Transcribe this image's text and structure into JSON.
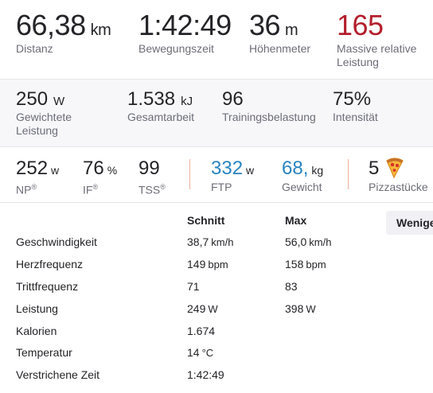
{
  "colors": {
    "accent_red": "#b41f2c",
    "accent_blue": "#2a84c2",
    "label_gray": "#6d6d78",
    "divider_orange": "#f0b29a"
  },
  "top_stats": [
    {
      "value": "66,38",
      "unit": "km",
      "label": "Distanz"
    },
    {
      "value": "1:42:49",
      "unit": "",
      "label": "Bewegungszeit"
    },
    {
      "value": "36",
      "unit": "m",
      "label": "Höhenmeter"
    },
    {
      "value": "165",
      "unit": "",
      "label_line1": "Massive relative",
      "label_line2": "Leistung"
    }
  ],
  "power_stats": [
    {
      "value": "250",
      "unit": "W",
      "label_line1": "Gewichtete",
      "label_line2": "Leistung"
    },
    {
      "value": "1.538",
      "unit": "kJ",
      "label": "Gesamtarbeit"
    },
    {
      "value": "96",
      "unit": "",
      "label": "Trainingsbelastung"
    },
    {
      "value": "75%",
      "unit": "",
      "label": "Intensität"
    }
  ],
  "metrics": [
    {
      "value": "252",
      "unit": "w",
      "label": "NP",
      "reg": "®"
    },
    {
      "value": "76",
      "unit": "%",
      "label": "IF",
      "reg": "®"
    },
    {
      "value": "99",
      "unit": "",
      "label": "TSS",
      "reg": "®"
    },
    {
      "value": "332",
      "unit": "w",
      "label": "FTP"
    },
    {
      "value": "68,",
      "unit": "kg",
      "label": "Gewicht"
    },
    {
      "value": "5",
      "unit": "",
      "label": "Pizzastücke",
      "icon": "pizza-icon"
    }
  ],
  "table": {
    "col_avg": "Schnitt",
    "col_max": "Max",
    "less_button": "Wenige",
    "rows": [
      {
        "label": "Geschwindigkeit",
        "avg": "38,7",
        "avg_unit": "km/h",
        "max": "56,0",
        "max_unit": "km/h"
      },
      {
        "label": "Herzfrequenz",
        "avg": "149",
        "avg_unit": "bpm",
        "max": "158",
        "max_unit": "bpm"
      },
      {
        "label": "Trittfrequenz",
        "avg": "71",
        "avg_unit": "",
        "max": "83",
        "max_unit": ""
      },
      {
        "label": "Leistung",
        "avg": "249",
        "avg_unit": "W",
        "max": "398",
        "max_unit": "W"
      },
      {
        "label": "Kalorien",
        "avg": "1.674",
        "avg_unit": "",
        "max": "",
        "max_unit": ""
      },
      {
        "label": "Temperatur",
        "avg": "14",
        "avg_unit": "°C",
        "max": "",
        "max_unit": ""
      },
      {
        "label": "Verstrichene Zeit",
        "avg": "1:42:49",
        "avg_unit": "",
        "max": "",
        "max_unit": ""
      }
    ]
  }
}
